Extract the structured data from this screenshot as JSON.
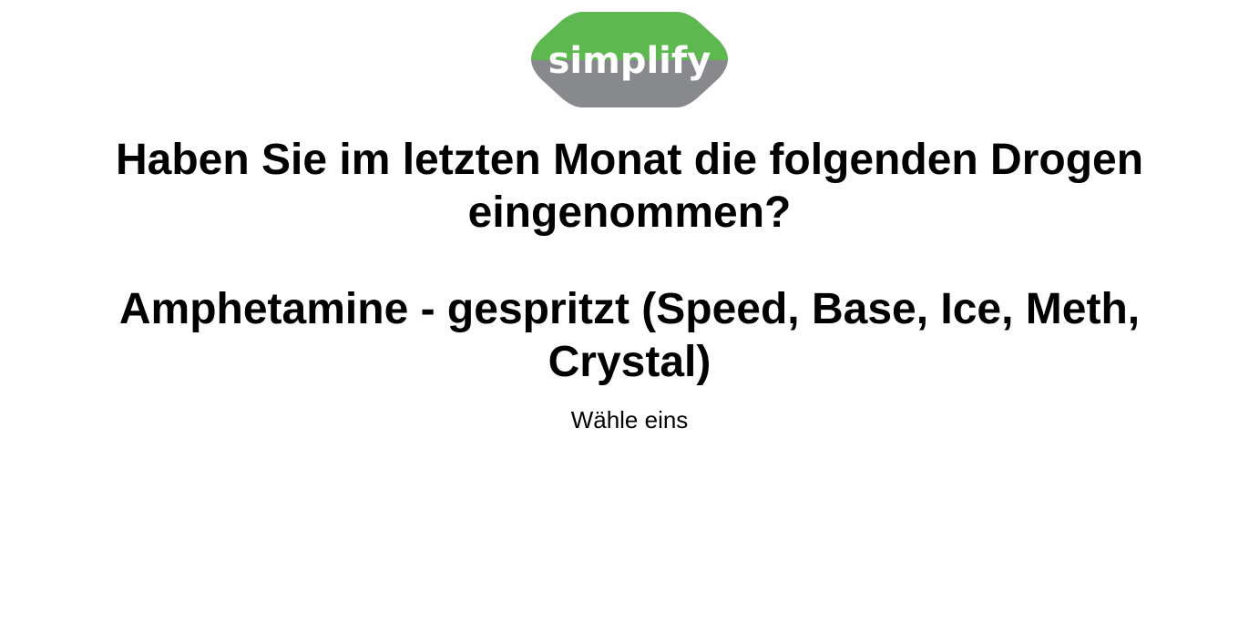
{
  "logo": {
    "text": "simplify",
    "color_top": "#5cb84f",
    "color_bottom": "#88898c"
  },
  "question": {
    "main": "Haben Sie im letzten Monat die folgenden Drogen eingenommen?",
    "substance": "Amphetamine - gespritzt (Speed, Base, Ice, Meth, Crystal)"
  },
  "hint": "Wähle eins"
}
